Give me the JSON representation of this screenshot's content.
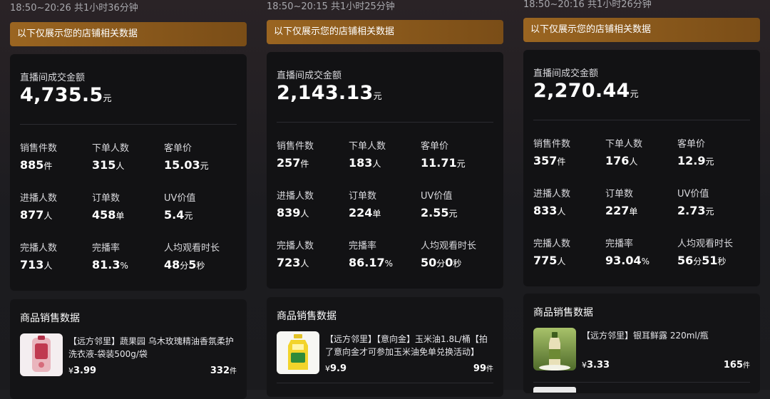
{
  "colors": {
    "accent": "#8c5a1c",
    "card": "#121214",
    "text_dim": "#d8d8dc"
  },
  "columns": [
    {
      "time": "18:50~20:26 共1小时36分钟",
      "notice": "以下仅展示您的店铺相关数据",
      "gmv_label": "直播间成交金额",
      "gmv_value": "4,735.5",
      "gmv_unit": "元",
      "metrics": [
        {
          "label": "销售件数",
          "value": "885",
          "unit": "件"
        },
        {
          "label": "下单人数",
          "value": "315",
          "unit": "人"
        },
        {
          "label": "客单价",
          "value": "15.03",
          "unit": "元"
        },
        {
          "label": "进播人数",
          "value": "877",
          "unit": "人"
        },
        {
          "label": "订单数",
          "value": "458",
          "unit": "单"
        },
        {
          "label": "UV价值",
          "value": "5.4",
          "unit": "元"
        },
        {
          "label": "完播人数",
          "value": "713",
          "unit": "人"
        },
        {
          "label": "完播率",
          "value": "81.3",
          "unit": "%"
        },
        {
          "label": "人均观看时长",
          "value": "48",
          "unit": "分",
          "value2": "5",
          "unit2": "秒"
        }
      ],
      "goods_title": "商品销售数据",
      "goods": {
        "name": "【远方邻里】蔬果园 乌木玫瑰精油香氛柔护洗衣液-袋装500g/袋",
        "price_symbol": "¥",
        "price": "3.99",
        "count": "332",
        "count_unit": "件",
        "thumb_icon": "detergent-bag-icon"
      }
    },
    {
      "time": "18:50~20:15 共1小时25分钟",
      "notice": "以下仅展示您的店铺相关数据",
      "gmv_label": "直播间成交金额",
      "gmv_value": "2,143.13",
      "gmv_unit": "元",
      "metrics": [
        {
          "label": "销售件数",
          "value": "257",
          "unit": "件"
        },
        {
          "label": "下单人数",
          "value": "183",
          "unit": "人"
        },
        {
          "label": "客单价",
          "value": "11.71",
          "unit": "元"
        },
        {
          "label": "进播人数",
          "value": "839",
          "unit": "人"
        },
        {
          "label": "订单数",
          "value": "224",
          "unit": "单"
        },
        {
          "label": "UV价值",
          "value": "2.55",
          "unit": "元"
        },
        {
          "label": "完播人数",
          "value": "723",
          "unit": "人"
        },
        {
          "label": "完播率",
          "value": "86.17",
          "unit": "%"
        },
        {
          "label": "人均观看时长",
          "value": "50",
          "unit": "分",
          "value2": "0",
          "unit2": "秒"
        }
      ],
      "goods_title": "商品销售数据",
      "goods": {
        "name": "【远方邻里】【意向金】玉米油1.8L/桶【拍了意向金才可参加玉米油免单兑换活动】",
        "price_symbol": "¥",
        "price": "9.9",
        "count": "99",
        "count_unit": "件",
        "thumb_icon": "oil-bottle-icon"
      }
    },
    {
      "time": "18:50~20:16 共1小时26分钟",
      "notice": "以下仅展示您的店铺相关数据",
      "gmv_label": "直播间成交金额",
      "gmv_value": "2,270.44",
      "gmv_unit": "元",
      "metrics": [
        {
          "label": "销售件数",
          "value": "357",
          "unit": "件"
        },
        {
          "label": "下单人数",
          "value": "176",
          "unit": "人"
        },
        {
          "label": "客单价",
          "value": "12.9",
          "unit": "元"
        },
        {
          "label": "进播人数",
          "value": "833",
          "unit": "人"
        },
        {
          "label": "订单数",
          "value": "227",
          "unit": "单"
        },
        {
          "label": "UV价值",
          "value": "2.73",
          "unit": "元"
        },
        {
          "label": "完播人数",
          "value": "775",
          "unit": "人"
        },
        {
          "label": "完播率",
          "value": "93.04",
          "unit": "%"
        },
        {
          "label": "人均观看时长",
          "value": "56",
          "unit": "分",
          "value2": "51",
          "unit2": "秒"
        }
      ],
      "goods_title": "商品销售数据",
      "goods": {
        "name": "【远方邻里】银耳鲜露 220ml/瓶",
        "price_symbol": "¥",
        "price": "3.33",
        "count": "165",
        "count_unit": "件",
        "thumb_icon": "drink-bottle-icon"
      }
    }
  ]
}
